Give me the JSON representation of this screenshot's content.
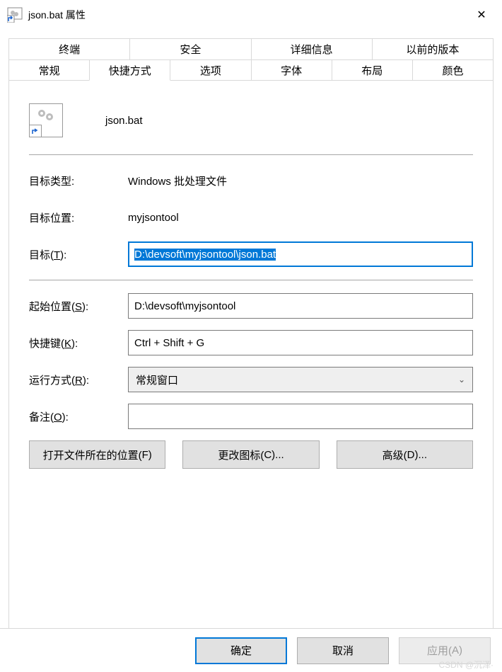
{
  "window": {
    "title": "json.bat 属性",
    "close_glyph": "✕"
  },
  "tabs": {
    "row1": [
      "终端",
      "安全",
      "详细信息",
      "以前的版本"
    ],
    "row2": [
      "常规",
      "快捷方式",
      "选项",
      "字体",
      "布局",
      "颜色"
    ],
    "active": "快捷方式"
  },
  "header": {
    "filename": "json.bat"
  },
  "fields": {
    "target_type": {
      "label": "目标类型:",
      "value": "Windows 批处理文件"
    },
    "target_location": {
      "label": "目标位置:",
      "value": "myjsontool"
    },
    "target": {
      "label_pre": "目标(",
      "label_u": "T",
      "label_post": "):",
      "value": "D:\\devsoft\\myjsontool\\json.bat"
    },
    "start_in": {
      "label_pre": "起始位置(",
      "label_u": "S",
      "label_post": "):",
      "value": "D:\\devsoft\\myjsontool"
    },
    "shortcut_key": {
      "label_pre": "快捷键(",
      "label_u": "K",
      "label_post": "):",
      "value": "Ctrl + Shift + G"
    },
    "run": {
      "label_pre": "运行方式(",
      "label_u": "R",
      "label_post": "):",
      "value": "常规窗口"
    },
    "comment": {
      "label_pre": "备注(",
      "label_u": "O",
      "label_post": "):",
      "value": ""
    }
  },
  "action_buttons": {
    "open_location": {
      "pre": "打开文件所在的位置(",
      "u": "F",
      "post": ")"
    },
    "change_icon": {
      "pre": "更改图标(",
      "u": "C",
      "post": ")..."
    },
    "advanced": {
      "pre": "高级(",
      "u": "D",
      "post": ")..."
    }
  },
  "bottom": {
    "ok": "确定",
    "cancel": "取消",
    "apply": {
      "pre": "应用(",
      "u": "A",
      "post": ")"
    }
  },
  "watermark": "CSDN @沉泽·"
}
